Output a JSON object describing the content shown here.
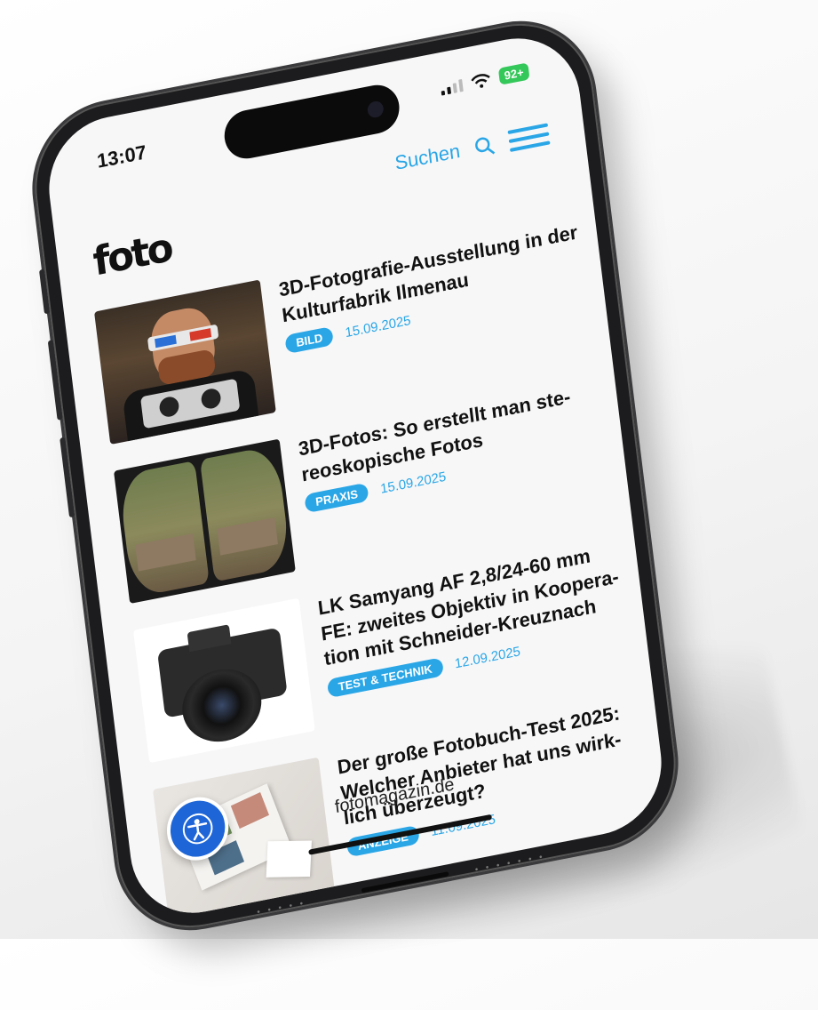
{
  "status_bar": {
    "time": "13:07",
    "battery": "92+"
  },
  "header": {
    "logo": "foto",
    "search_label": "Suchen"
  },
  "articles": [
    {
      "title": "3D-Fotografie-Ausstellung in der Kulturfabrik Ilmenau",
      "category": "BILD",
      "date": "15.09.2025",
      "image": "man-with-3d-glasses-and-stereo-camera"
    },
    {
      "title": "3D-Fotos: So erstellt man ste-reoskopische Fotos",
      "category": "PRAXIS",
      "date": "15.09.2025",
      "image": "stereoscopic-forest-bench"
    },
    {
      "title": "LK Samyang AF 2,8/24-60 mm FE: zweites Objektiv in Koopera-tion mit Schneider-Kreuznach",
      "category": "TEST & TECHNIK",
      "date": "12.09.2025",
      "image": "sony-camera-with-lens"
    },
    {
      "title": "Der große Fotobuch-Test 2025: Welcher Anbieter hat uns wirk-lich überzeugt?",
      "category": "ANZEIGE",
      "date": "11.09.2025",
      "image": "photo-book-on-table"
    }
  ],
  "footer": {
    "url": "fotomagazin.de"
  },
  "icons": {
    "search": "search-icon",
    "menu": "hamburger-menu-icon",
    "accessibility": "accessibility-icon"
  },
  "colors": {
    "accent": "#2aa6e6",
    "accessibility_button": "#1e66d8",
    "battery": "#34c759"
  }
}
